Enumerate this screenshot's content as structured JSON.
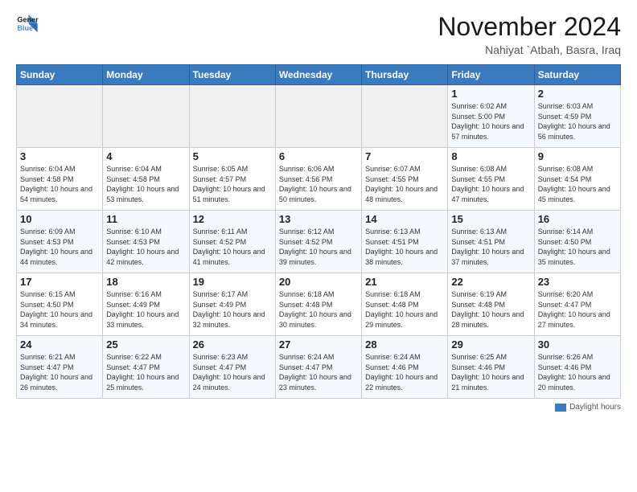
{
  "header": {
    "logo_line1": "General",
    "logo_line2": "Blue",
    "month": "November 2024",
    "location": "Nahiyat `Atbah, Basra, Iraq"
  },
  "days_of_week": [
    "Sunday",
    "Monday",
    "Tuesday",
    "Wednesday",
    "Thursday",
    "Friday",
    "Saturday"
  ],
  "weeks": [
    [
      {
        "day": "",
        "info": ""
      },
      {
        "day": "",
        "info": ""
      },
      {
        "day": "",
        "info": ""
      },
      {
        "day": "",
        "info": ""
      },
      {
        "day": "",
        "info": ""
      },
      {
        "day": "1",
        "info": "Sunrise: 6:02 AM\nSunset: 5:00 PM\nDaylight: 10 hours and 57 minutes."
      },
      {
        "day": "2",
        "info": "Sunrise: 6:03 AM\nSunset: 4:59 PM\nDaylight: 10 hours and 56 minutes."
      }
    ],
    [
      {
        "day": "3",
        "info": "Sunrise: 6:04 AM\nSunset: 4:58 PM\nDaylight: 10 hours and 54 minutes."
      },
      {
        "day": "4",
        "info": "Sunrise: 6:04 AM\nSunset: 4:58 PM\nDaylight: 10 hours and 53 minutes."
      },
      {
        "day": "5",
        "info": "Sunrise: 6:05 AM\nSunset: 4:57 PM\nDaylight: 10 hours and 51 minutes."
      },
      {
        "day": "6",
        "info": "Sunrise: 6:06 AM\nSunset: 4:56 PM\nDaylight: 10 hours and 50 minutes."
      },
      {
        "day": "7",
        "info": "Sunrise: 6:07 AM\nSunset: 4:55 PM\nDaylight: 10 hours and 48 minutes."
      },
      {
        "day": "8",
        "info": "Sunrise: 6:08 AM\nSunset: 4:55 PM\nDaylight: 10 hours and 47 minutes."
      },
      {
        "day": "9",
        "info": "Sunrise: 6:08 AM\nSunset: 4:54 PM\nDaylight: 10 hours and 45 minutes."
      }
    ],
    [
      {
        "day": "10",
        "info": "Sunrise: 6:09 AM\nSunset: 4:53 PM\nDaylight: 10 hours and 44 minutes."
      },
      {
        "day": "11",
        "info": "Sunrise: 6:10 AM\nSunset: 4:53 PM\nDaylight: 10 hours and 42 minutes."
      },
      {
        "day": "12",
        "info": "Sunrise: 6:11 AM\nSunset: 4:52 PM\nDaylight: 10 hours and 41 minutes."
      },
      {
        "day": "13",
        "info": "Sunrise: 6:12 AM\nSunset: 4:52 PM\nDaylight: 10 hours and 39 minutes."
      },
      {
        "day": "14",
        "info": "Sunrise: 6:13 AM\nSunset: 4:51 PM\nDaylight: 10 hours and 38 minutes."
      },
      {
        "day": "15",
        "info": "Sunrise: 6:13 AM\nSunset: 4:51 PM\nDaylight: 10 hours and 37 minutes."
      },
      {
        "day": "16",
        "info": "Sunrise: 6:14 AM\nSunset: 4:50 PM\nDaylight: 10 hours and 35 minutes."
      }
    ],
    [
      {
        "day": "17",
        "info": "Sunrise: 6:15 AM\nSunset: 4:50 PM\nDaylight: 10 hours and 34 minutes."
      },
      {
        "day": "18",
        "info": "Sunrise: 6:16 AM\nSunset: 4:49 PM\nDaylight: 10 hours and 33 minutes."
      },
      {
        "day": "19",
        "info": "Sunrise: 6:17 AM\nSunset: 4:49 PM\nDaylight: 10 hours and 32 minutes."
      },
      {
        "day": "20",
        "info": "Sunrise: 6:18 AM\nSunset: 4:48 PM\nDaylight: 10 hours and 30 minutes."
      },
      {
        "day": "21",
        "info": "Sunrise: 6:18 AM\nSunset: 4:48 PM\nDaylight: 10 hours and 29 minutes."
      },
      {
        "day": "22",
        "info": "Sunrise: 6:19 AM\nSunset: 4:48 PM\nDaylight: 10 hours and 28 minutes."
      },
      {
        "day": "23",
        "info": "Sunrise: 6:20 AM\nSunset: 4:47 PM\nDaylight: 10 hours and 27 minutes."
      }
    ],
    [
      {
        "day": "24",
        "info": "Sunrise: 6:21 AM\nSunset: 4:47 PM\nDaylight: 10 hours and 26 minutes."
      },
      {
        "day": "25",
        "info": "Sunrise: 6:22 AM\nSunset: 4:47 PM\nDaylight: 10 hours and 25 minutes."
      },
      {
        "day": "26",
        "info": "Sunrise: 6:23 AM\nSunset: 4:47 PM\nDaylight: 10 hours and 24 minutes."
      },
      {
        "day": "27",
        "info": "Sunrise: 6:24 AM\nSunset: 4:47 PM\nDaylight: 10 hours and 23 minutes."
      },
      {
        "day": "28",
        "info": "Sunrise: 6:24 AM\nSunset: 4:46 PM\nDaylight: 10 hours and 22 minutes."
      },
      {
        "day": "29",
        "info": "Sunrise: 6:25 AM\nSunset: 4:46 PM\nDaylight: 10 hours and 21 minutes."
      },
      {
        "day": "30",
        "info": "Sunrise: 6:26 AM\nSunset: 4:46 PM\nDaylight: 10 hours and 20 minutes."
      }
    ]
  ],
  "footer": {
    "legend_label": "Daylight hours"
  }
}
